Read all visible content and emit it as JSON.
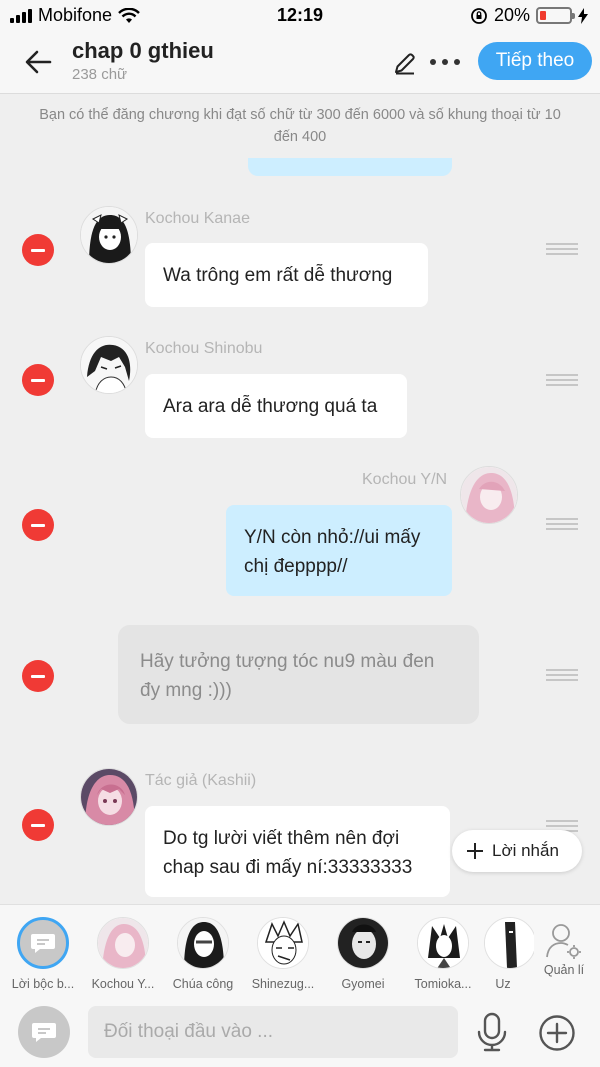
{
  "status_bar": {
    "carrier": "Mobifone",
    "time": "12:19",
    "battery": "20%",
    "battery_level": 0.2
  },
  "header": {
    "title": "chap 0 gthieu",
    "word_count": "238 chữ",
    "next_label": "Tiếp theo"
  },
  "notice": "Bạn có thể đăng chương khi đạt số chữ từ 300 đến 6000 và số khung thoại từ 10 đến 400",
  "messages": [
    {
      "speaker": "Kochou Kanae",
      "text": "Wa trông em rất dễ thương"
    },
    {
      "speaker": "Kochou Shinobu",
      "text": "Ara ara dễ thương quá ta"
    },
    {
      "speaker": "Kochou Y/N",
      "text": "Y/N còn nhỏ://ui mấy chị đepppp//"
    },
    {
      "speaker": "",
      "text": "Hãy tưởng tượng tóc nu9 màu đen đy mng :)))"
    },
    {
      "speaker": "Tác giả (Kashii)",
      "text": "Do tg lười viết thêm nên đợi chap sau đi mấy ní:33333333"
    }
  ],
  "add_note_label": "Lời nhắn",
  "characters": [
    {
      "label": "Lời bộc b..."
    },
    {
      "label": "Kochou Y..."
    },
    {
      "label": "Chúa công"
    },
    {
      "label": "Shinezug..."
    },
    {
      "label": "Gyomei"
    },
    {
      "label": "Tomioka..."
    },
    {
      "label": "Uz"
    }
  ],
  "manage_label": "Quản lí",
  "input": {
    "placeholder": "Đối thoại đầu vào ..."
  },
  "colors": {
    "accent": "#3fa6f3",
    "remove": "#f03a35",
    "my_bubble": "#cdeeff",
    "battery": "#f03a2e"
  }
}
